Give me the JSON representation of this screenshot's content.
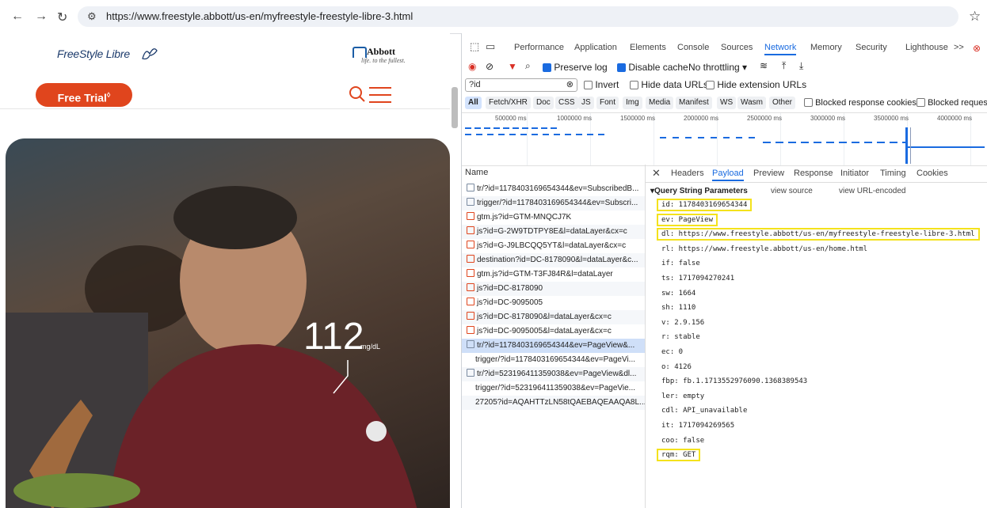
{
  "browser": {
    "url": "https://www.freestyle.abbott/us-en/myfreestyle-freestyle-libre-3.html",
    "nav_icons": [
      "back-arrow-icon",
      "forward-arrow-icon",
      "reload-icon",
      "site-settings-icon",
      "bookmark-star-icon"
    ]
  },
  "site": {
    "logo_text": "FreeStyle Libre",
    "brand_name": "Abbott",
    "brand_tagline": "life. to the fullest.",
    "cta_label": "Free Trial",
    "cta_superscript": "◊",
    "glucose_value": "112",
    "glucose_unit": "mg/dL",
    "accent_color": "#e0451d"
  },
  "devtools": {
    "tabs": [
      "Performance",
      "Application",
      "Elements",
      "Console",
      "Sources",
      "Network",
      "Memory",
      "Security",
      "Lighthouse",
      ">>"
    ],
    "active_tab": "Network",
    "toolbar": {
      "preserve_log": "Preserve log",
      "disable_cache": "Disable cache",
      "throttling": "No throttling"
    },
    "filter": {
      "value": "?id",
      "invert": "Invert",
      "hide_data_urls": "Hide data URLs",
      "hide_extension_urls": "Hide extension URLs"
    },
    "type_chips": [
      "All",
      "Fetch/XHR",
      "Doc",
      "CSS",
      "JS",
      "Font",
      "Img",
      "Media",
      "Manifest",
      "WS",
      "Wasm",
      "Other"
    ],
    "blocked_cookies": "Blocked response cookies",
    "blocked_requests": "Blocked requests",
    "timeline_ticks": [
      "500000 ms",
      "1000000 ms",
      "1500000 ms",
      "2000000 ms",
      "2500000 ms",
      "3000000 ms",
      "3500000 ms",
      "4000000 ms"
    ],
    "name_header": "Name",
    "requests": [
      {
        "name": "tr/?id=1178403169654344&ev=SubscribedB...",
        "type": "doc"
      },
      {
        "name": "trigger/?id=1178403169654344&ev=Subscri...",
        "type": "doc"
      },
      {
        "name": "gtm.js?id=GTM-MNQCJ7K",
        "type": "script"
      },
      {
        "name": "js?id=G-2W9TDTPY8E&l=dataLayer&cx=c",
        "type": "script"
      },
      {
        "name": "js?id=G-J9LBCQQ5YT&l=dataLayer&cx=c",
        "type": "script"
      },
      {
        "name": "destination?id=DC-8178090&l=dataLayer&c...",
        "type": "script"
      },
      {
        "name": "gtm.js?id=GTM-T3FJ84R&l=dataLayer",
        "type": "script"
      },
      {
        "name": "js?id=DC-8178090",
        "type": "script"
      },
      {
        "name": "js?id=DC-9095005",
        "type": "script"
      },
      {
        "name": "js?id=DC-8178090&l=dataLayer&cx=c",
        "type": "script"
      },
      {
        "name": "js?id=DC-9095005&l=dataLayer&cx=c",
        "type": "script"
      },
      {
        "name": "tr/?id=1178403169654344&ev=PageView&...",
        "type": "doc"
      },
      {
        "name": "trigger/?id=1178403169654344&ev=PageVi...",
        "type": "none"
      },
      {
        "name": "tr/?id=523196411359038&ev=PageView&dl...",
        "type": "doc"
      },
      {
        "name": "trigger/?id=523196411359038&ev=PageVie...",
        "type": "none"
      },
      {
        "name": "27205?id=AQAHTTzLN58tQAEBAQEAAQA8L...",
        "type": "none"
      }
    ],
    "detail_tabs": [
      "Headers",
      "Payload",
      "Preview",
      "Response",
      "Initiator",
      "Timing",
      "Cookies"
    ],
    "active_detail_tab": "Payload",
    "section_title": "▾Query String Parameters",
    "view_source": "view source",
    "view_url_encoded": "view URL-encoded",
    "params": [
      {
        "text": "id: 1178403169654344",
        "hl": true
      },
      {
        "text": "ev: PageView",
        "hl": true
      },
      {
        "text": "dl: https://www.freestyle.abbott/us-en/myfreestyle-freestyle-libre-3.html",
        "hl": true
      },
      {
        "text": "rl: https://www.freestyle.abbott/us-en/home.html",
        "hl": false
      },
      {
        "text": "if: false",
        "hl": false
      },
      {
        "text": "ts: 1717094270241",
        "hl": false
      },
      {
        "text": "sw: 1664",
        "hl": false
      },
      {
        "text": "sh: 1110",
        "hl": false
      },
      {
        "text": "v: 2.9.156",
        "hl": false
      },
      {
        "text": "r: stable",
        "hl": false
      },
      {
        "text": "ec: 0",
        "hl": false
      },
      {
        "text": "o: 4126",
        "hl": false
      },
      {
        "text": "fbp: fb.1.1713552976090.1368389543",
        "hl": false
      },
      {
        "text": "ler: empty",
        "hl": false
      },
      {
        "text": "cdl: API_unavailable",
        "hl": false
      },
      {
        "text": "it: 1717094269565",
        "hl": false
      },
      {
        "text": "coo: false",
        "hl": false
      },
      {
        "text": "rqm: GET",
        "hl": true
      }
    ]
  }
}
